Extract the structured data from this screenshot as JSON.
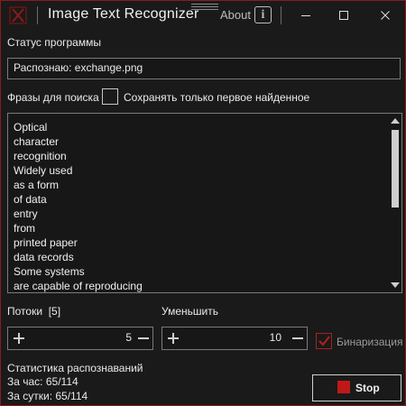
{
  "titlebar": {
    "title": "Image Text Recognizer",
    "about": "About",
    "info_glyph": "i",
    "icons": [
      "app-logo-icon",
      "drag-handle-icon",
      "info-icon",
      "minimize-icon",
      "maximize-icon",
      "close-icon"
    ]
  },
  "status": {
    "label": "Статус программы",
    "value": "Распознаю: exchange.png"
  },
  "search": {
    "label": "Фразы для поиска",
    "first_only_label": "Сохранять только первое найденное",
    "first_only_checked": false
  },
  "phrases": [
    "Optical",
    "character",
    "recognition",
    "Widely used",
    "as a form",
    "of data",
    "entry",
    "from",
    "printed paper",
    "data records",
    "Some systems",
    "are capable of reproducing"
  ],
  "threads": {
    "label": "Потоки",
    "count_label": "[5]",
    "value": "5"
  },
  "shrink": {
    "label": "Уменьшить",
    "value": "10"
  },
  "binarization": {
    "label": "Бинаризация",
    "checked": true
  },
  "stats": {
    "title": "Статистика распознаваний",
    "hour": "За час:  65/114",
    "day": "За сутки:  65/114"
  },
  "stop": {
    "label": "Stop"
  },
  "colors": {
    "background": "#1a1a1a",
    "border": "#8a1a1a",
    "accent_red": "#c01818"
  }
}
